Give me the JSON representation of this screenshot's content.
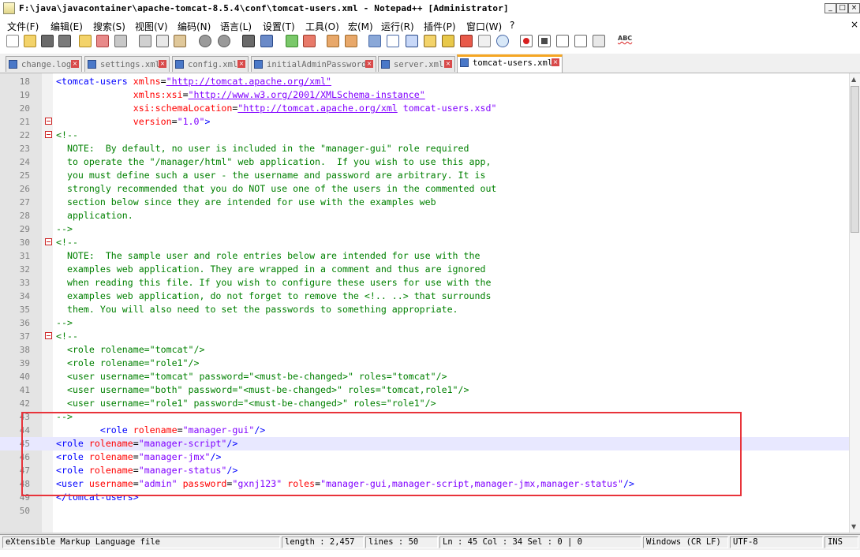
{
  "window": {
    "title": "F:\\java\\javacontainer\\apache-tomcat-8.5.4\\conf\\tomcat-users.xml - Notepad++ [Administrator]"
  },
  "menu": [
    "文件(F)",
    "编辑(E)",
    "搜索(S)",
    "视图(V)",
    "编码(N)",
    "语言(L)",
    "设置(T)",
    "工具(O)",
    "宏(M)",
    "运行(R)",
    "插件(P)",
    "窗口(W)",
    "?"
  ],
  "toolbar_icons": [
    "new-file-icon",
    "open-file-icon",
    "save-icon",
    "save-all-icon",
    "close-icon",
    "close-all-icon",
    "print-icon",
    "cut-icon",
    "copy-icon",
    "paste-icon",
    "undo-icon",
    "redo-icon",
    "find-icon",
    "replace-icon",
    "zoom-in-icon",
    "zoom-out-icon",
    "sync-vertical-icon",
    "sync-horizontal-icon",
    "word-wrap-icon",
    "show-all-chars-icon",
    "indent-guide-icon",
    "doc-map-icon",
    "function-list-icon",
    "folder-workspace-icon",
    "doc-switcher-icon",
    "monitor-icon",
    "record-macro-icon",
    "stop-macro-icon",
    "play-macro-icon",
    "run-macro-multiple-icon",
    "save-macro-icon",
    "spell-check-icon"
  ],
  "tabs": [
    {
      "label": "change.log"
    },
    {
      "label": "settings.xml"
    },
    {
      "label": "config.xml"
    },
    {
      "label": "initialAdminPassword"
    },
    {
      "label": "server.xml"
    },
    {
      "label": "tomcat-users.xml",
      "active": true
    }
  ],
  "editor": {
    "current_line": 45,
    "lines": [
      {
        "n": "18",
        "fold": false,
        "tokens": [
          [
            "t",
            "<tomcat-users "
          ],
          [
            "a",
            "xmlns"
          ],
          [
            "e",
            "="
          ],
          [
            "u",
            "\"http://tomcat.apache.org/xml\""
          ]
        ]
      },
      {
        "n": "19",
        "fold": false,
        "tokens": [
          [
            "p",
            "              "
          ],
          [
            "a",
            "xmlns:xsi"
          ],
          [
            "e",
            "="
          ],
          [
            "u",
            "\"http://www.w3.org/2001/XMLSchema-instance\""
          ]
        ]
      },
      {
        "n": "20",
        "fold": false,
        "tokens": [
          [
            "p",
            "              "
          ],
          [
            "a",
            "xsi:schemaLocation"
          ],
          [
            "e",
            "="
          ],
          [
            "u",
            "\"http://tomcat.apache.org/xml"
          ],
          [
            "s",
            " tomcat-users.xsd\""
          ]
        ]
      },
      {
        "n": "21",
        "fold": true,
        "tokens": [
          [
            "p",
            "              "
          ],
          [
            "a",
            "version"
          ],
          [
            "e",
            "="
          ],
          [
            "s",
            "\"1.0\""
          ],
          [
            "t",
            ">"
          ]
        ]
      },
      {
        "n": "22",
        "fold": true,
        "tokens": [
          [
            "c",
            "<!--"
          ]
        ]
      },
      {
        "n": "23",
        "fold": false,
        "tokens": [
          [
            "c",
            "  NOTE:  By default, no user is included in the \"manager-gui\" role required"
          ]
        ]
      },
      {
        "n": "24",
        "fold": false,
        "tokens": [
          [
            "c",
            "  to operate the \"/manager/html\" web application.  If you wish to use this app,"
          ]
        ]
      },
      {
        "n": "25",
        "fold": false,
        "tokens": [
          [
            "c",
            "  you must define such a user - the username and password are arbitrary. It is"
          ]
        ]
      },
      {
        "n": "26",
        "fold": false,
        "tokens": [
          [
            "c",
            "  strongly recommended that you do NOT use one of the users in the commented out"
          ]
        ]
      },
      {
        "n": "27",
        "fold": false,
        "tokens": [
          [
            "c",
            "  section below since they are intended for use with the examples web"
          ]
        ]
      },
      {
        "n": "28",
        "fold": false,
        "tokens": [
          [
            "c",
            "  application."
          ]
        ]
      },
      {
        "n": "29",
        "fold": false,
        "tokens": [
          [
            "c",
            "-->"
          ]
        ]
      },
      {
        "n": "30",
        "fold": true,
        "tokens": [
          [
            "c",
            "<!--"
          ]
        ]
      },
      {
        "n": "31",
        "fold": false,
        "tokens": [
          [
            "c",
            "  NOTE:  The sample user and role entries below are intended for use with the"
          ]
        ]
      },
      {
        "n": "32",
        "fold": false,
        "tokens": [
          [
            "c",
            "  examples web application. They are wrapped in a comment and thus are ignored"
          ]
        ]
      },
      {
        "n": "33",
        "fold": false,
        "tokens": [
          [
            "c",
            "  when reading this file. If you wish to configure these users for use with the"
          ]
        ]
      },
      {
        "n": "34",
        "fold": false,
        "tokens": [
          [
            "c",
            "  examples web application, do not forget to remove the <!.. ..> that surrounds"
          ]
        ]
      },
      {
        "n": "35",
        "fold": false,
        "tokens": [
          [
            "c",
            "  them. You will also need to set the passwords to something appropriate."
          ]
        ]
      },
      {
        "n": "36",
        "fold": false,
        "tokens": [
          [
            "c",
            "-->"
          ]
        ]
      },
      {
        "n": "37",
        "fold": true,
        "tokens": [
          [
            "c",
            "<!--"
          ]
        ]
      },
      {
        "n": "38",
        "fold": false,
        "tokens": [
          [
            "c",
            "  <role rolename=\"tomcat\"/>"
          ]
        ]
      },
      {
        "n": "39",
        "fold": false,
        "tokens": [
          [
            "c",
            "  <role rolename=\"role1\"/>"
          ]
        ]
      },
      {
        "n": "40",
        "fold": false,
        "tokens": [
          [
            "c",
            "  <user username=\"tomcat\" password=\"<must-be-changed>\" roles=\"tomcat\"/>"
          ]
        ]
      },
      {
        "n": "41",
        "fold": false,
        "tokens": [
          [
            "c",
            "  <user username=\"both\" password=\"<must-be-changed>\" roles=\"tomcat,role1\"/>"
          ]
        ]
      },
      {
        "n": "42",
        "fold": false,
        "tokens": [
          [
            "c",
            "  <user username=\"role1\" password=\"<must-be-changed>\" roles=\"role1\"/>"
          ]
        ]
      },
      {
        "n": "43",
        "fold": false,
        "tokens": [
          [
            "c",
            "-->"
          ]
        ]
      },
      {
        "n": "44",
        "fold": false,
        "tokens": [
          [
            "p",
            "        "
          ],
          [
            "t",
            "<role "
          ],
          [
            "a",
            "rolename"
          ],
          [
            "e",
            "="
          ],
          [
            "s",
            "\"manager-gui\""
          ],
          [
            "t",
            "/>"
          ]
        ]
      },
      {
        "n": "45",
        "fold": false,
        "tokens": [
          [
            "t",
            "<role "
          ],
          [
            "a",
            "rolename"
          ],
          [
            "e",
            "="
          ],
          [
            "s",
            "\"manager-script\""
          ],
          [
            "t",
            "/>"
          ]
        ]
      },
      {
        "n": "46",
        "fold": false,
        "tokens": [
          [
            "t",
            "<role "
          ],
          [
            "a",
            "rolename"
          ],
          [
            "e",
            "="
          ],
          [
            "s",
            "\"manager-jmx\""
          ],
          [
            "t",
            "/>"
          ]
        ]
      },
      {
        "n": "47",
        "fold": false,
        "tokens": [
          [
            "t",
            "<role "
          ],
          [
            "a",
            "rolename"
          ],
          [
            "e",
            "="
          ],
          [
            "s",
            "\"manager-status\""
          ],
          [
            "t",
            "/>"
          ]
        ]
      },
      {
        "n": "48",
        "fold": false,
        "tokens": [
          [
            "t",
            "<user "
          ],
          [
            "a",
            "username"
          ],
          [
            "e",
            "="
          ],
          [
            "s",
            "\"admin\""
          ],
          [
            "a",
            " password"
          ],
          [
            "e",
            "="
          ],
          [
            "s",
            "\"gxnj123\""
          ],
          [
            "a",
            " roles"
          ],
          [
            "e",
            "="
          ],
          [
            "s",
            "\"manager-gui,manager-script,manager-jmx,manager-status\""
          ],
          [
            "t",
            "/>"
          ]
        ]
      },
      {
        "n": "49",
        "fold": false,
        "tokens": [
          [
            "t",
            "</tomcat-users>"
          ]
        ]
      },
      {
        "n": "50",
        "fold": false,
        "tokens": []
      }
    ]
  },
  "status": {
    "filetype": "eXtensible Markup Language file",
    "length": "length : 2,457",
    "lines": "lines : 50",
    "position": "Ln : 45    Col : 34    Sel : 0 | 0",
    "eol": "Windows (CR LF)",
    "encoding": "UTF-8",
    "mode": "INS"
  },
  "colors": {
    "tag": "#0000ff",
    "attr": "#ff0000",
    "string": "#8000ff",
    "comment": "#008000",
    "highlight_box": "#e8333a",
    "active_tab_accent": "#f5a623"
  }
}
